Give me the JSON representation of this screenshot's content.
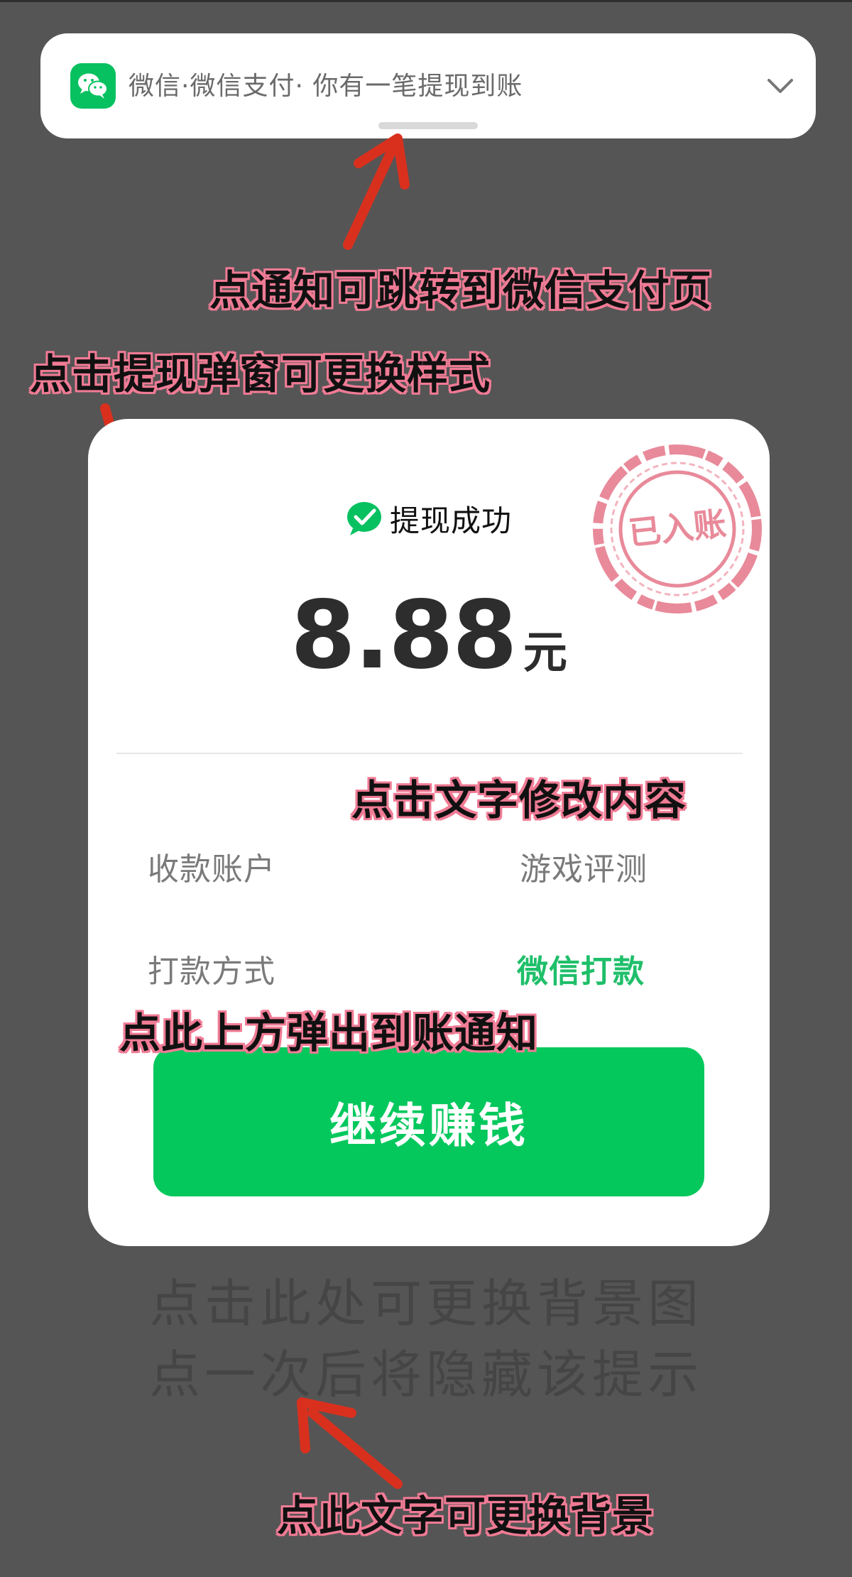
{
  "notification": {
    "app_icon": "wechat-icon",
    "text": "微信·微信支付· 你有一笔提现到账",
    "chevron_icon": "chevron-down-icon"
  },
  "annotations": {
    "notify_tip": "点通知可跳转到微信支付页",
    "popup_tip": "点击提现弹窗可更换样式",
    "edit_tip": "点击文字修改内容",
    "trigger_tip": "点此上方弹出到账通知",
    "background_tip": "点此文字可更换背景"
  },
  "card": {
    "status_icon": "check-circle-icon",
    "status_text": "提现成功",
    "stamp_text": "已入账",
    "amount": "8.88",
    "unit": "元",
    "rows": [
      {
        "label": "收款账户",
        "value": "游戏评测"
      },
      {
        "label": "打款方式",
        "value": "微信打款"
      }
    ],
    "cta_label": "继续赚钱"
  },
  "hint": {
    "line1": "点击此处可更换背景图",
    "line2": "点一次后将隐藏该提示"
  },
  "colors": {
    "background": "#555555",
    "wechat_green": "#07c160",
    "button_green": "#05c85d",
    "stamp_pink": "#e88a9a",
    "annotation_outline": "#f07b95",
    "arrow_red": "#d9301e"
  }
}
